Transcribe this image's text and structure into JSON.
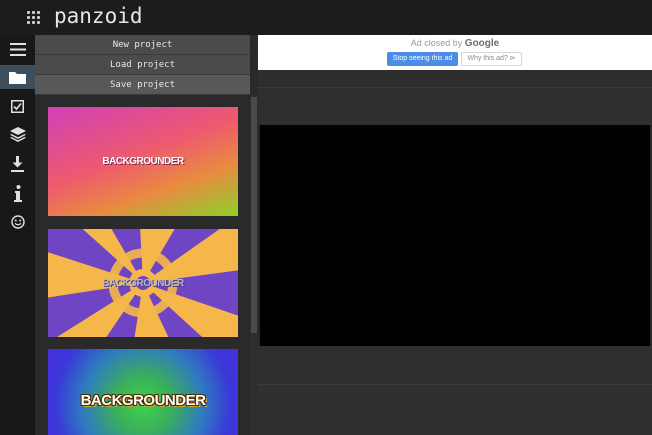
{
  "app": {
    "logo": "panzoid"
  },
  "iconbar": {
    "items": [
      {
        "icon": "hamburger-menu-icon"
      },
      {
        "icon": "folder-icon",
        "active": true
      },
      {
        "icon": "checkbox-icon"
      },
      {
        "icon": "layers-icon"
      },
      {
        "icon": "download-icon"
      },
      {
        "icon": "info-icon"
      },
      {
        "icon": "smiley-icon"
      }
    ]
  },
  "project_menu": {
    "new_label": "New project",
    "load_label": "Load project",
    "save_label": "Save project"
  },
  "templates": [
    {
      "title": "BACKGROUNDER",
      "style": "gradient-pink-green"
    },
    {
      "title": "BACKGROUNDER",
      "style": "spiral-purple-orange"
    },
    {
      "title": "BACKGROUNDER",
      "style": "radial-green-blue"
    }
  ],
  "ad": {
    "closed_text": "Ad closed by",
    "provider": "Google",
    "stop_label": "Stop seeing this ad",
    "why_label": "Why this ad? ⊳"
  },
  "colors": {
    "accent": "#3d4f5c",
    "ad_button": "#4b8de6"
  }
}
